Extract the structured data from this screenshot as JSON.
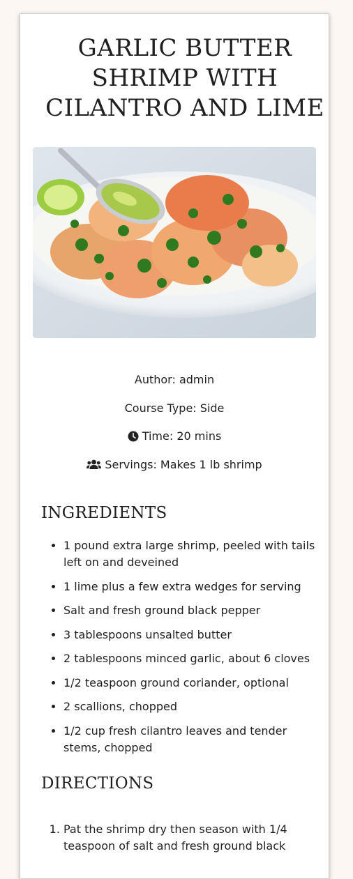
{
  "recipe": {
    "title": "GARLIC BUTTER SHRIMP WITH CILANTRO AND LIME",
    "image_alt": "Garlic butter shrimp in a white bowl with cilantro and lime",
    "author": "Author: admin",
    "course": "Course Type: Side",
    "time": "Time: 20 mins",
    "servings": "Servings: Makes 1 lb shrimp"
  },
  "icons": {
    "time": "clock-icon",
    "servings": "users-icon"
  },
  "ingredients": {
    "heading": "INGREDIENTS",
    "items": [
      "1 pound extra large shrimp, peeled with tails left on and deveined",
      "1 lime plus a few extra wedges for serving",
      "Salt and fresh ground black pepper",
      "3 tablespoons unsalted butter",
      "2 tablespoons minced garlic, about 6 cloves",
      "1/2 teaspoon ground coriander, optional",
      "2 scallions, chopped",
      "1/2 cup fresh cilantro leaves and tender stems, chopped"
    ]
  },
  "directions": {
    "heading": "DIRECTIONS",
    "items": [
      "Pat the shrimp dry then season with 1/4 teaspoon of salt and fresh ground black"
    ]
  },
  "colors": {
    "page_background": "#fcf7f3",
    "card_background": "#ffffff",
    "text": "#1f1f1f"
  }
}
